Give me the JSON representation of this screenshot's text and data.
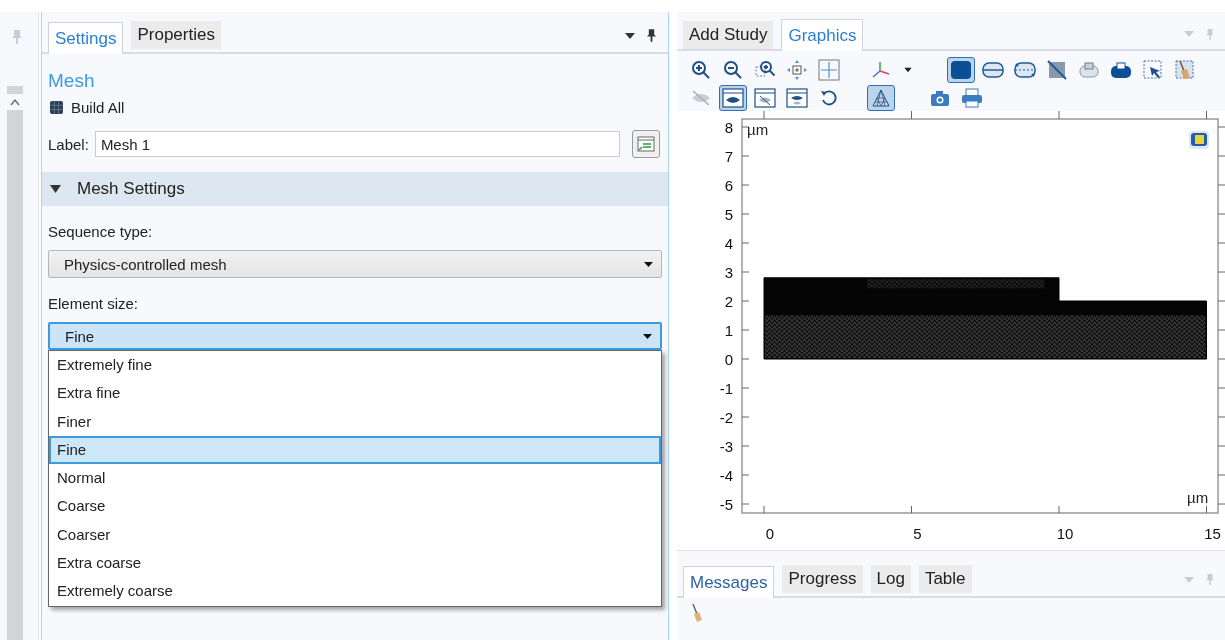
{
  "settings_panel": {
    "tabs": [
      {
        "label": "Settings",
        "selected": true
      },
      {
        "label": "Properties",
        "selected": false
      }
    ],
    "title": "Mesh",
    "build_button": "Build All",
    "label_field": {
      "label": "Label:",
      "value": "Mesh 1"
    },
    "section": {
      "title": "Mesh Settings",
      "expanded": true
    },
    "sequence_type": {
      "label": "Sequence type:",
      "value": "Physics-controlled mesh"
    },
    "element_size": {
      "label": "Element size:",
      "value": "Fine",
      "open": true,
      "options": [
        {
          "label": "Extremely fine",
          "selected": false
        },
        {
          "label": "Extra fine",
          "selected": false
        },
        {
          "label": "Finer",
          "selected": false
        },
        {
          "label": "Fine",
          "selected": true
        },
        {
          "label": "Normal",
          "selected": false
        },
        {
          "label": "Coarse",
          "selected": false
        },
        {
          "label": "Coarser",
          "selected": false
        },
        {
          "label": "Extra coarse",
          "selected": false
        },
        {
          "label": "Extremely coarse",
          "selected": false
        }
      ]
    }
  },
  "graphics_panel": {
    "tabs": [
      {
        "label": "Add Study",
        "selected": false
      },
      {
        "label": "Graphics",
        "selected": true
      }
    ],
    "toolbar": [
      [
        [
          {
            "kind": "zoom-in",
            "selected": false
          },
          {
            "kind": "zoom-out",
            "selected": false
          },
          {
            "kind": "zoom-box",
            "selected": false
          },
          {
            "kind": "move",
            "selected": false
          },
          {
            "kind": "extents",
            "selected": false
          }
        ],
        [
          {
            "kind": "axes",
            "selected": false
          },
          {
            "kind": "caret",
            "selected": false
          }
        ],
        [
          {
            "kind": "solid",
            "selected": true
          },
          {
            "kind": "split",
            "selected": false
          },
          {
            "kind": "dotted",
            "selected": false
          },
          {
            "kind": "off",
            "selected": false
          },
          {
            "kind": "device",
            "selected": false
          },
          {
            "kind": "device-filled",
            "selected": false
          },
          {
            "kind": "select-box",
            "selected": false
          },
          {
            "kind": "clear",
            "selected": false
          }
        ]
      ],
      [
        [
          {
            "kind": "hide",
            "selected": false
          },
          {
            "kind": "eye-window",
            "selected": true
          },
          {
            "kind": "hide-window",
            "selected": false
          },
          {
            "kind": "eye-swap",
            "selected": false
          },
          {
            "kind": "reset",
            "selected": false
          }
        ],
        [
          {
            "kind": "mesh",
            "selected": true
          }
        ],
        [
          {
            "kind": "camera",
            "selected": false
          },
          {
            "kind": "printer",
            "selected": false
          }
        ]
      ]
    ],
    "plot": {
      "y_unit": "µm",
      "x_unit": "µm",
      "y_ticks": [
        "8",
        "7",
        "6",
        "5",
        "4",
        "3",
        "2",
        "1",
        "0",
        "-1",
        "-2",
        "-3",
        "-4",
        "-5"
      ],
      "x_ticks": [
        "0",
        "5",
        "10",
        "15"
      ]
    }
  },
  "messages_panel": {
    "tabs": [
      {
        "label": "Messages",
        "selected": true
      },
      {
        "label": "Progress",
        "selected": false
      },
      {
        "label": "Log",
        "selected": false
      },
      {
        "label": "Table",
        "selected": false
      }
    ]
  }
}
